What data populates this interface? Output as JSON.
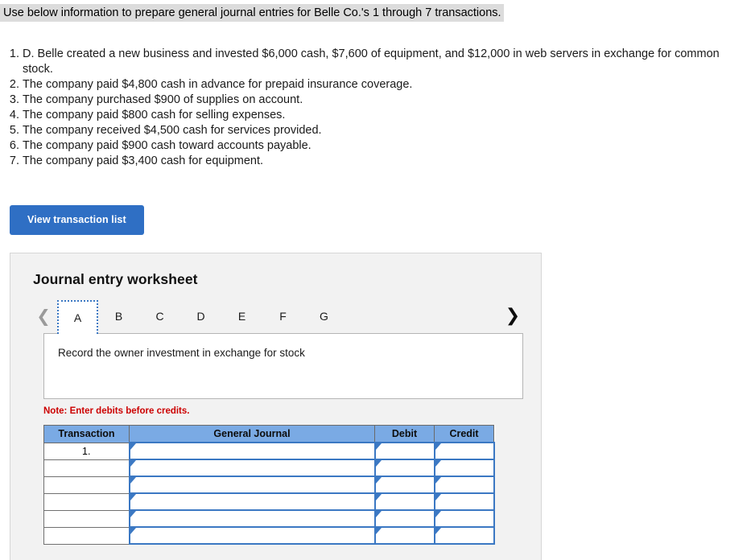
{
  "banner": {
    "text": "Use below information to prepare general journal entries for Belle Co.'s 1 through 7 transactions."
  },
  "transactions": [
    {
      "num": "1.",
      "text": "D. Belle created a new business and invested $6,000 cash, $7,600 of equipment, and $12,000 in web servers in exchange for common stock."
    },
    {
      "num": "2.",
      "text": "The company paid $4,800 cash in advance for prepaid insurance coverage."
    },
    {
      "num": "3.",
      "text": "The company purchased $900 of supplies on account."
    },
    {
      "num": "4.",
      "text": "The company paid $800 cash for selling expenses."
    },
    {
      "num": "5.",
      "text": "The company received $4,500 cash for services provided."
    },
    {
      "num": "6.",
      "text": "The company paid $900 cash toward accounts payable."
    },
    {
      "num": "7.",
      "text": "The company paid $3,400 cash for equipment."
    }
  ],
  "view_button": {
    "label": "View transaction list"
  },
  "worksheet": {
    "title": "Journal entry worksheet",
    "prev_icon": "chevron-left-icon",
    "next_icon": "chevron-right-icon",
    "tabs": [
      {
        "label": "A",
        "active": true
      },
      {
        "label": "B",
        "active": false
      },
      {
        "label": "C",
        "active": false
      },
      {
        "label": "D",
        "active": false
      },
      {
        "label": "E",
        "active": false
      },
      {
        "label": "F",
        "active": false
      },
      {
        "label": "G",
        "active": false
      }
    ],
    "prompt": "Record the owner investment in exchange for stock",
    "note": "Note: Enter debits before credits.",
    "table": {
      "headers": [
        "Transaction",
        "General Journal",
        "Debit",
        "Credit"
      ],
      "rows": [
        {
          "transaction": "1.",
          "general_journal": "",
          "debit": "",
          "credit": ""
        },
        {
          "transaction": "",
          "general_journal": "",
          "debit": "",
          "credit": ""
        },
        {
          "transaction": "",
          "general_journal": "",
          "debit": "",
          "credit": ""
        },
        {
          "transaction": "",
          "general_journal": "",
          "debit": "",
          "credit": ""
        },
        {
          "transaction": "",
          "general_journal": "",
          "debit": "",
          "credit": ""
        },
        {
          "transaction": "",
          "general_journal": "",
          "debit": "",
          "credit": ""
        }
      ]
    }
  },
  "colors": {
    "accent_blue": "#2f6fc4",
    "header_blue": "#7aaae4",
    "cell_border_blue": "#3b78c3",
    "note_red": "#cc0000",
    "banner_highlight": "#dcdcdc",
    "panel_bg": "#f2f2f2"
  }
}
